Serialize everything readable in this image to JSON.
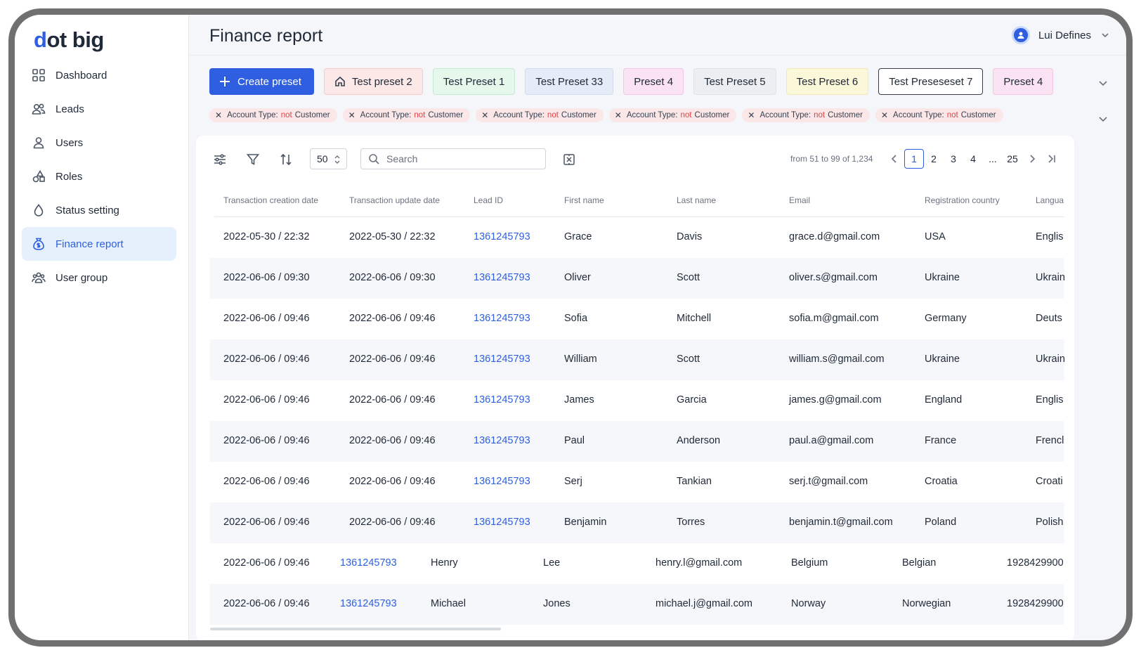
{
  "app": {
    "logo_d": "d",
    "logo_rest": "ot big"
  },
  "sidebar": {
    "items": [
      {
        "label": "Dashboard",
        "icon": "grid-icon"
      },
      {
        "label": "Leads",
        "icon": "users-icon"
      },
      {
        "label": "Users",
        "icon": "user-icon"
      },
      {
        "label": "Roles",
        "icon": "shapes-icon"
      },
      {
        "label": "Status setting",
        "icon": "drop-icon"
      },
      {
        "label": "Finance report",
        "icon": "money-bag-icon",
        "active": true
      },
      {
        "label": "User group",
        "icon": "user-group-icon"
      }
    ]
  },
  "header": {
    "title": "Finance report",
    "user_name": "Lui Defines"
  },
  "presets": {
    "create_label": "Create preset",
    "items": [
      {
        "label": "Test preset 2",
        "bg": "#fde8e8",
        "border": "#f7c9c9",
        "home": true
      },
      {
        "label": "Test Preset 1",
        "bg": "#e6f7ec",
        "border": "#c4ead2"
      },
      {
        "label": "Test Preset 33",
        "bg": "#e6ecf7",
        "border": "#d3dcef"
      },
      {
        "label": "Preset 4",
        "bg": "#fbe3f3",
        "border": "#f3c6e4"
      },
      {
        "label": "Test Preset 5",
        "bg": "#eceef1",
        "border": "#dfe2e7"
      },
      {
        "label": "Test Preset 6",
        "bg": "#fbf8d9",
        "border": "#eeeab2"
      },
      {
        "label": "Test Preseseset 7",
        "bg": "#ffffff",
        "border": "#3a3f47"
      },
      {
        "label": "Preset 4",
        "bg": "#fbe3f3",
        "border": "#f3c6e4"
      }
    ]
  },
  "filters": {
    "items": [
      {
        "key": "Account Type:",
        "neg": "not",
        "value": "Customer"
      },
      {
        "key": "Account Type:",
        "neg": "not",
        "value": "Customer"
      },
      {
        "key": "Account Type:",
        "neg": "not",
        "value": "Customer"
      },
      {
        "key": "Account Type:",
        "neg": "not",
        "value": "Customer"
      },
      {
        "key": "Account Type:",
        "neg": "not",
        "value": "Customer"
      },
      {
        "key": "Account Type:",
        "neg": "not",
        "value": "Customer"
      }
    ]
  },
  "toolbar": {
    "per_page": "50",
    "search_placeholder": "Search",
    "range": "from 51 to 99 of 1,234"
  },
  "pagination": {
    "pages": [
      "1",
      "2",
      "3",
      "4",
      "...",
      "25"
    ],
    "current": "1"
  },
  "table": {
    "columns": [
      "Transaction creation date",
      "Transaction update date",
      "Lead ID",
      "First name",
      "Last name",
      "Email",
      "Registration country",
      "Langua"
    ],
    "rows": [
      [
        "2022-05-30 / 22:32",
        "2022-05-30 / 22:32",
        "1361245793",
        "Grace",
        "Davis",
        "grace.d@gmail.com",
        "USA",
        "Englis"
      ],
      [
        "2022-06-06 / 09:30",
        "2022-06-06 / 09:30",
        "1361245793",
        "Oliver",
        "Scott",
        "oliver.s@gmail.com",
        "Ukraine",
        "Ukrain"
      ],
      [
        "2022-06-06 / 09:46",
        "2022-06-06 / 09:46",
        "1361245793",
        "Sofia",
        "Mitchell",
        "sofia.m@gmail.com",
        "Germany",
        "Deuts"
      ],
      [
        "2022-06-06 / 09:46",
        "2022-06-06 / 09:46",
        "1361245793",
        "William",
        "Scott",
        "william.s@gmail.com",
        "Ukraine",
        "Ukrain"
      ],
      [
        "2022-06-06 / 09:46",
        "2022-06-06 / 09:46",
        "1361245793",
        "James",
        "Garcia",
        "james.g@gmail.com",
        "England",
        "Englis"
      ],
      [
        "2022-06-06 / 09:46",
        "2022-06-06 / 09:46",
        "1361245793",
        "Paul",
        "Anderson",
        "paul.a@gmail.com",
        "France",
        "Frencl"
      ],
      [
        "2022-06-06 / 09:46",
        "2022-06-06 / 09:46",
        "1361245793",
        "Serj",
        "Tankian",
        "serj.t@gmail.com",
        "Croatia",
        "Croati"
      ],
      [
        "2022-06-06 / 09:46",
        "2022-06-06 / 09:46",
        "1361245793",
        "Benjamin",
        "Torres",
        "benjamin.t@gmail.com",
        "Poland",
        "Polish"
      ]
    ],
    "shifted_rows": [
      [
        "2022-06-06 / 09:46",
        "1361245793",
        "Henry",
        "Lee",
        "henry.l@gmail.com",
        "Belgium",
        "Belgian",
        "1928429900"
      ],
      [
        "2022-06-06 / 09:46",
        "1361245793",
        "Michael",
        "Jones",
        "michael.j@gmail.com",
        "Norway",
        "Norwegian",
        "1928429900"
      ]
    ]
  }
}
